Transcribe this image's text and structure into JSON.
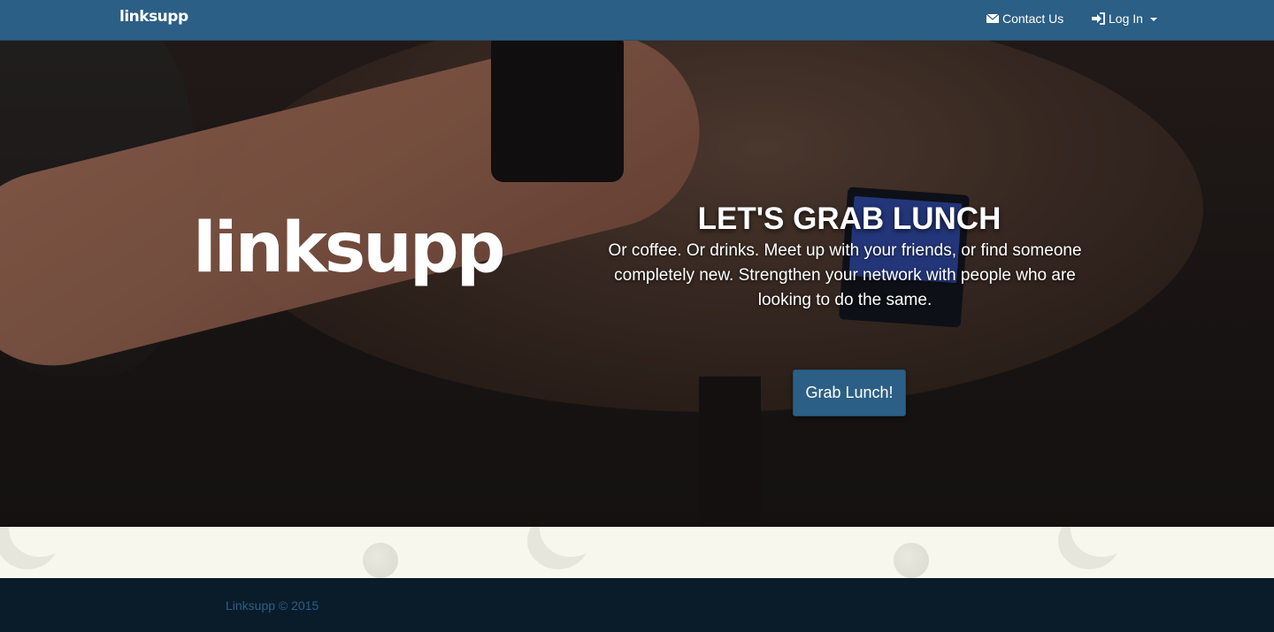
{
  "navbar": {
    "brand": "linksupp",
    "contact_label": "Contact Us",
    "login_label": "Log In",
    "contact_icon": "envelope-icon",
    "login_icon": "sign-in-icon",
    "dropdown_icon": "caret-down-icon"
  },
  "hero": {
    "logo_text": "linksupp",
    "title": "LET'S GRAB LUNCH",
    "text": "Or coffee. Or drinks. Meet up with your friends, or find someone completely new. Strengthen your network with people who are looking to do the same.",
    "cta_label": "Grab Lunch!"
  },
  "footer": {
    "copyright": "Linksupp © 2015"
  },
  "colors": {
    "brand": "#2c5f85",
    "footer_bg": "#0a1c2a",
    "strip_bg": "#f7f7ee"
  }
}
